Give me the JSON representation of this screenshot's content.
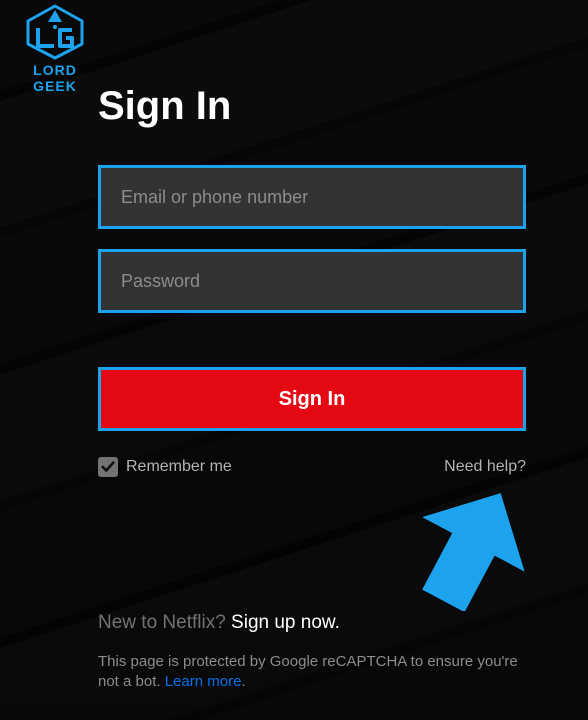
{
  "brand": {
    "name": "LORD GEEK"
  },
  "header": {
    "title": "Sign In"
  },
  "form": {
    "email_placeholder": "Email or phone number",
    "password_placeholder": "Password",
    "submit_label": "Sign In",
    "remember_label": "Remember me",
    "remember_checked": true,
    "help_label": "Need help?"
  },
  "footer": {
    "signup_prefix": "New to Netflix? ",
    "signup_link": "Sign up now",
    "signup_suffix": ".",
    "captcha_text": "This page is protected by Google reCAPTCHA to ensure you're not a bot. ",
    "learn_more": "Learn more",
    "learn_suffix": "."
  },
  "colors": {
    "highlight": "#1da3ee",
    "primary": "#e50914",
    "link": "#0071eb"
  }
}
